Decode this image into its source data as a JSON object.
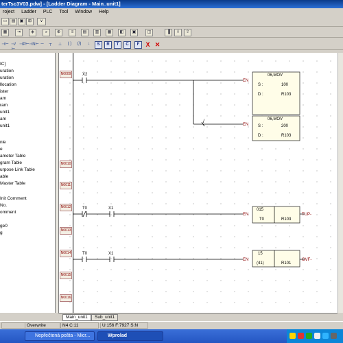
{
  "window": {
    "title": "terTsc3V03.pdw] - [Ladder Diagram - Main_unit1]"
  },
  "menu": [
    "roject",
    "Ladder",
    "PLC",
    "Tool",
    "Window",
    "Help"
  ],
  "tree": {
    "items": [
      "IC]",
      "uration",
      "uration",
      "llocation",
      "ister",
      "am",
      "ram",
      "unit1",
      "am",
      "unit1",
      "",
      "nle",
      "e",
      "ameter Table",
      "gram Table",
      "urpose Link Table",
      "able",
      "Master Table",
      "",
      "Init Comment",
      "No.",
      "omment",
      "",
      "ge0",
      "g"
    ]
  },
  "rungs": {
    "numbers": [
      "N0009",
      "N0010",
      "N0011",
      "N0012",
      "N0013",
      "N0014",
      "N0015",
      "N0016"
    ]
  },
  "ladder": {
    "contact_x2": "X2",
    "contact_t0a": "T0",
    "contact_x1a": "X1",
    "contact_t0b": "T0",
    "contact_x1b": "X1",
    "branch_slash": "/",
    "en": "EN",
    "box1": {
      "title": "06,MOV",
      "s_label": "S :",
      "s_value": "100",
      "d_label": "D :",
      "d_value": "R103"
    },
    "box2": {
      "title": "06,MOV",
      "s_label": "S :",
      "s_value": "200",
      "d_label": "D :",
      "d_value": "R103"
    },
    "box3": {
      "title": "015",
      "left": "T0",
      "right": "R103",
      "out": "TUP-"
    },
    "box4": {
      "title": "15",
      "left": "(41)",
      "right": "R101",
      "out": "OVF-"
    }
  },
  "tabs": [
    "Main_unit1",
    "Sub_unit1"
  ],
  "status": {
    "mode": "Overwrite",
    "pos": "N4 C:11",
    "info": "U:156 F:7927 S:N"
  },
  "taskbar": {
    "item1": "Nepřečtená pošta - Micr...",
    "item2": "Wprolad"
  },
  "toolbar3_buttons": [
    "S",
    "R",
    "T",
    "C",
    "F",
    "X"
  ],
  "colors": {
    "accent": "#0a3a8a",
    "rung_text": "#8b0000",
    "delete": "#d10000"
  }
}
